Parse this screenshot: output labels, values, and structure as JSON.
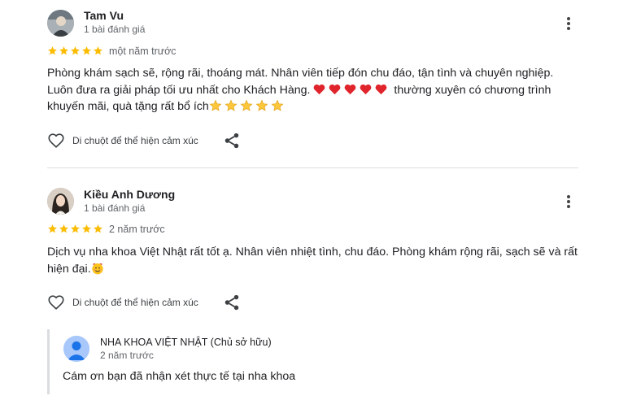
{
  "reviews": [
    {
      "name": "Tam Vu",
      "review_count": "1 bài đánh giá",
      "rating": 5,
      "time": "một năm trước",
      "text_before_hearts": "Phòng khám sạch sẽ, rộng rãi, thoáng mát. Nhân viên tiếp đón chu đáo, tận tình và chuyên nghiệp. Luôn đưa ra giải pháp tối ưu nhất cho Khách Hàng.",
      "text_after_hearts": "thường xuyên có chương trình khuyến mãi, quà tặng rất bổ ích",
      "emoji_hearts": 5,
      "emoji_stars": 5,
      "like_label": "Di chuột để thể hiện cảm xúc"
    },
    {
      "name": "Kiều Anh Dương",
      "review_count": "1 bài đánh giá",
      "rating": 5,
      "time": "2 năm trước",
      "text": "Dịch vụ nha khoa Việt Nhật rất tốt ạ. Nhân viên nhiệt tình, chu đáo. Phòng khám rộng rãi, sạch sẽ và rất hiện đại.",
      "like_label": "Di chuột để thể hiện cảm xúc"
    }
  ],
  "owner_reply": {
    "name": "NHA KHOA VIỆT NHẬT (Chủ sở hữu)",
    "time": "2 năm trước",
    "text": "Cám ơn bạn đã nhận xét thực tế tại nha khoa"
  },
  "colors": {
    "star": "#fbbc04",
    "emoji_heart": "#e0242c",
    "emoji_star": "#fdc73c",
    "divider": "#dadce0"
  },
  "icons": [
    "more-vert-icon",
    "heart-outline-icon",
    "share-icon",
    "star-icon",
    "user-avatar-icon"
  ]
}
